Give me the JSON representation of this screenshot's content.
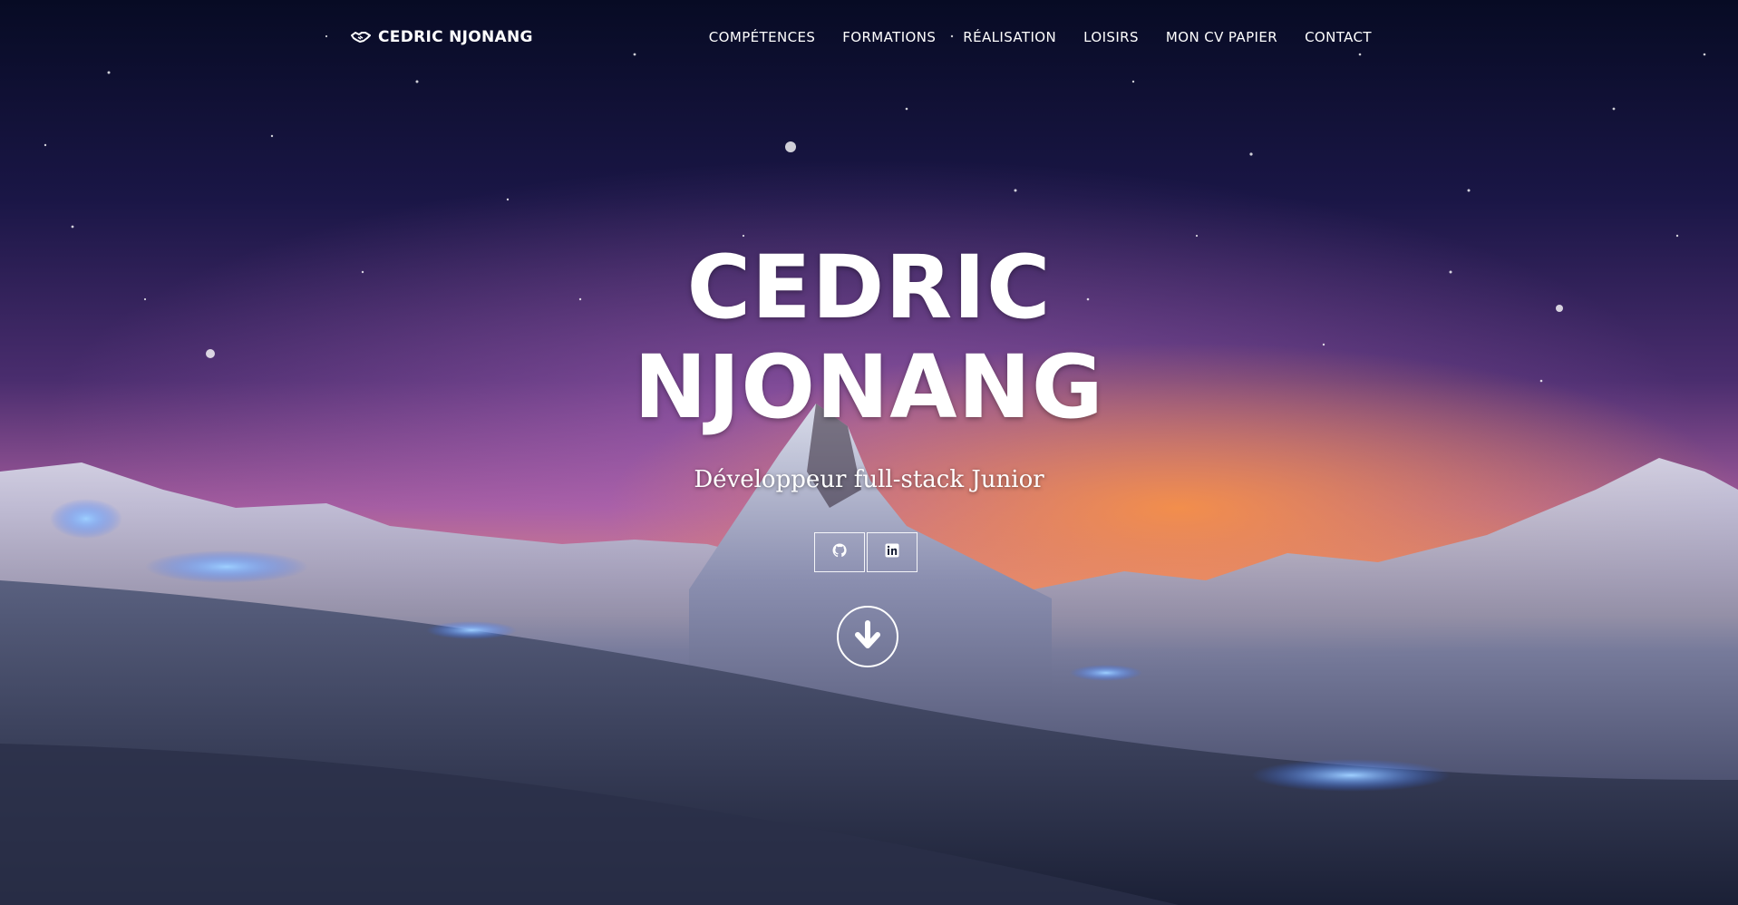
{
  "brand": {
    "name": "CEDRIC NJONANG",
    "icon": "handshake-icon"
  },
  "nav": {
    "items": [
      {
        "label": "COMPÉTENCES"
      },
      {
        "label": "FORMATIONS"
      },
      {
        "label": "RÉALISATION"
      },
      {
        "label": "LOISIRS"
      },
      {
        "label": "MON CV PAPIER"
      },
      {
        "label": "CONTACT"
      }
    ]
  },
  "hero": {
    "title_line1": "CEDRIC",
    "title_line2": "NJONANG",
    "subtitle": "Développeur full-stack Junior",
    "social_icons": [
      "github-icon",
      "linkedin-icon"
    ],
    "scroll_icon": "arrow-down-circle-icon"
  },
  "colors": {
    "text": "#ffffff",
    "sky_top": "#070b24",
    "horizon": "#e89a58"
  }
}
